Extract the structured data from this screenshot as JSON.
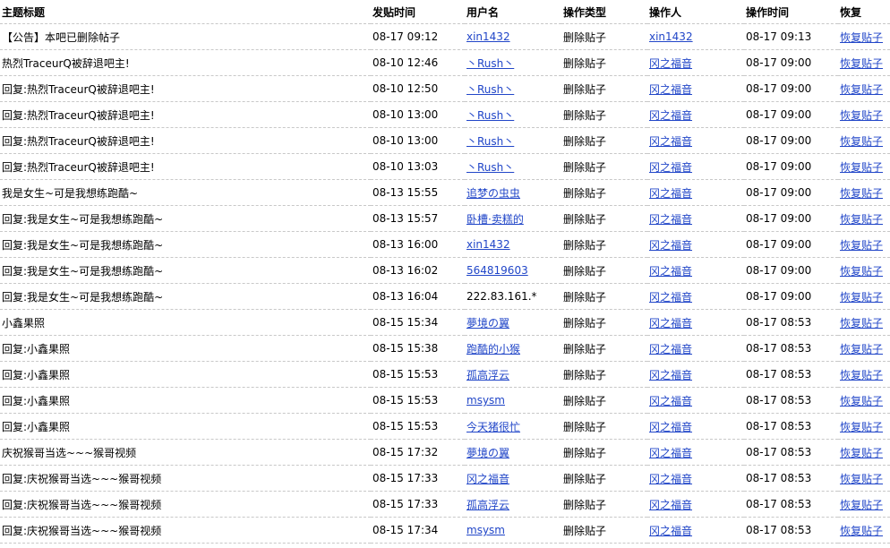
{
  "headers": {
    "title": "主题标题",
    "post_time": "发贴时间",
    "username": "用户名",
    "op_type": "操作类型",
    "operator": "操作人",
    "op_time": "操作时间",
    "restore": "恢复"
  },
  "colors": {
    "link": "#2146c8",
    "divider": "#c8c8c8"
  },
  "rows": [
    {
      "title": "【公告】本吧已删除帖子",
      "post_time": "08-17 09:12",
      "user": "xin1432",
      "user_link": true,
      "op_type": "删除贴子",
      "operator": "xin1432",
      "op_time": "08-17 09:13",
      "restore": "恢复贴子"
    },
    {
      "title": "热烈TraceurQ被辞退吧主!",
      "post_time": "08-10 12:46",
      "user": "丶Rush丶",
      "user_link": true,
      "op_type": "删除贴子",
      "operator": "冈之福音",
      "op_time": "08-17 09:00",
      "restore": "恢复贴子"
    },
    {
      "title": "回复:热烈TraceurQ被辞退吧主!",
      "post_time": "08-10 12:50",
      "user": "丶Rush丶",
      "user_link": true,
      "op_type": "删除贴子",
      "operator": "冈之福音",
      "op_time": "08-17 09:00",
      "restore": "恢复贴子"
    },
    {
      "title": "回复:热烈TraceurQ被辞退吧主!",
      "post_time": "08-10 13:00",
      "user": "丶Rush丶",
      "user_link": true,
      "op_type": "删除贴子",
      "operator": "冈之福音",
      "op_time": "08-17 09:00",
      "restore": "恢复贴子"
    },
    {
      "title": "回复:热烈TraceurQ被辞退吧主!",
      "post_time": "08-10 13:00",
      "user": "丶Rush丶",
      "user_link": true,
      "op_type": "删除贴子",
      "operator": "冈之福音",
      "op_time": "08-17 09:00",
      "restore": "恢复贴子"
    },
    {
      "title": "回复:热烈TraceurQ被辞退吧主!",
      "post_time": "08-10 13:03",
      "user": "丶Rush丶",
      "user_link": true,
      "op_type": "删除贴子",
      "operator": "冈之福音",
      "op_time": "08-17 09:00",
      "restore": "恢复贴子"
    },
    {
      "title": "我是女生~可是我想练跑酷~",
      "post_time": "08-13 15:55",
      "user": "追梦の虫虫",
      "user_link": true,
      "op_type": "删除贴子",
      "operator": "冈之福音",
      "op_time": "08-17 09:00",
      "restore": "恢复贴子"
    },
    {
      "title": "回复:我是女生~可是我想练跑酷~",
      "post_time": "08-13 15:57",
      "user": "卧槽·卖糕的",
      "user_link": true,
      "op_type": "删除贴子",
      "operator": "冈之福音",
      "op_time": "08-17 09:00",
      "restore": "恢复贴子"
    },
    {
      "title": "回复:我是女生~可是我想练跑酷~",
      "post_time": "08-13 16:00",
      "user": "xin1432",
      "user_link": true,
      "op_type": "删除贴子",
      "operator": "冈之福音",
      "op_time": "08-17 09:00",
      "restore": "恢复贴子"
    },
    {
      "title": "回复:我是女生~可是我想练跑酷~",
      "post_time": "08-13 16:02",
      "user": "564819603",
      "user_link": true,
      "op_type": "删除贴子",
      "operator": "冈之福音",
      "op_time": "08-17 09:00",
      "restore": "恢复贴子"
    },
    {
      "title": "回复:我是女生~可是我想练跑酷~",
      "post_time": "08-13 16:04",
      "user": "222.83.161.*",
      "user_link": false,
      "op_type": "删除贴子",
      "operator": "冈之福音",
      "op_time": "08-17 09:00",
      "restore": "恢复贴子"
    },
    {
      "title": "小鑫果照",
      "post_time": "08-15 15:34",
      "user": "夢境の翼",
      "user_link": true,
      "op_type": "删除贴子",
      "operator": "冈之福音",
      "op_time": "08-17 08:53",
      "restore": "恢复贴子"
    },
    {
      "title": "回复:小鑫果照",
      "post_time": "08-15 15:38",
      "user": "跑酷的小猴",
      "user_link": true,
      "op_type": "删除贴子",
      "operator": "冈之福音",
      "op_time": "08-17 08:53",
      "restore": "恢复贴子"
    },
    {
      "title": "回复:小鑫果照",
      "post_time": "08-15 15:53",
      "user": "孤高浮云",
      "user_link": true,
      "op_type": "删除贴子",
      "operator": "冈之福音",
      "op_time": "08-17 08:53",
      "restore": "恢复贴子"
    },
    {
      "title": "回复:小鑫果照",
      "post_time": "08-15 15:53",
      "user": "msysm",
      "user_link": true,
      "op_type": "删除贴子",
      "operator": "冈之福音",
      "op_time": "08-17 08:53",
      "restore": "恢复贴子"
    },
    {
      "title": "回复:小鑫果照",
      "post_time": "08-15 15:53",
      "user": "今天猪很忙",
      "user_link": true,
      "op_type": "删除贴子",
      "operator": "冈之福音",
      "op_time": "08-17 08:53",
      "restore": "恢复贴子"
    },
    {
      "title": "庆祝猴哥当选~~~猴哥视频",
      "post_time": "08-15 17:32",
      "user": "夢境の翼",
      "user_link": true,
      "op_type": "删除贴子",
      "operator": "冈之福音",
      "op_time": "08-17 08:53",
      "restore": "恢复贴子"
    },
    {
      "title": "回复:庆祝猴哥当选~~~猴哥视频",
      "post_time": "08-15 17:33",
      "user": "冈之福音",
      "user_link": true,
      "op_type": "删除贴子",
      "operator": "冈之福音",
      "op_time": "08-17 08:53",
      "restore": "恢复贴子"
    },
    {
      "title": "回复:庆祝猴哥当选~~~猴哥视频",
      "post_time": "08-15 17:33",
      "user": "孤高浮云",
      "user_link": true,
      "op_type": "删除贴子",
      "operator": "冈之福音",
      "op_time": "08-17 08:53",
      "restore": "恢复贴子"
    },
    {
      "title": "回复:庆祝猴哥当选~~~猴哥视频",
      "post_time": "08-15 17:34",
      "user": "msysm",
      "user_link": true,
      "op_type": "删除贴子",
      "operator": "冈之福音",
      "op_time": "08-17 08:53",
      "restore": "恢复贴子"
    }
  ]
}
